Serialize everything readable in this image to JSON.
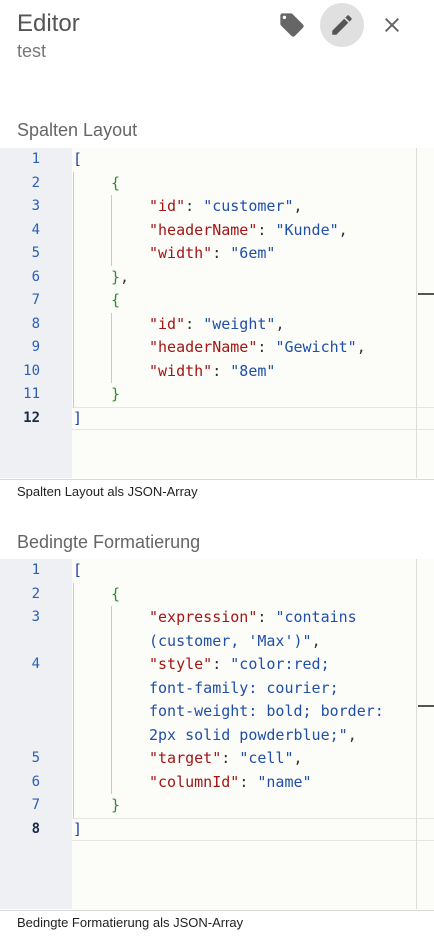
{
  "header": {
    "title": "Editor",
    "subtitle": "test"
  },
  "toolbar": {
    "tag_icon": "label-icon",
    "edit_icon": "pencil-icon",
    "close_icon": "close-icon"
  },
  "section1": {
    "title": "Spalten Layout",
    "hint": "Spalten Layout als JSON-Array",
    "lines": [
      {
        "n": "1",
        "indent": 0,
        "parts": [
          {
            "c": "p",
            "t": "["
          }
        ]
      },
      {
        "n": "2",
        "indent": 1,
        "parts": [
          {
            "c": "p2",
            "t": "{"
          }
        ]
      },
      {
        "n": "3",
        "indent": 2,
        "parts": [
          {
            "c": "k",
            "t": "\"id\""
          },
          {
            "c": "t",
            "t": ": "
          },
          {
            "c": "s",
            "t": "\"customer\""
          },
          {
            "c": "t",
            "t": ","
          }
        ]
      },
      {
        "n": "4",
        "indent": 2,
        "parts": [
          {
            "c": "k",
            "t": "\"headerName\""
          },
          {
            "c": "t",
            "t": ": "
          },
          {
            "c": "s",
            "t": "\"Kunde\""
          },
          {
            "c": "t",
            "t": ","
          }
        ]
      },
      {
        "n": "5",
        "indent": 2,
        "parts": [
          {
            "c": "k",
            "t": "\"width\""
          },
          {
            "c": "t",
            "t": ": "
          },
          {
            "c": "s",
            "t": "\"6em\""
          }
        ]
      },
      {
        "n": "6",
        "indent": 1,
        "parts": [
          {
            "c": "p2",
            "t": "}"
          },
          {
            "c": "t",
            "t": ","
          }
        ]
      },
      {
        "n": "7",
        "indent": 1,
        "parts": [
          {
            "c": "p2",
            "t": "{"
          }
        ]
      },
      {
        "n": "8",
        "indent": 2,
        "parts": [
          {
            "c": "k",
            "t": "\"id\""
          },
          {
            "c": "t",
            "t": ": "
          },
          {
            "c": "s",
            "t": "\"weight\""
          },
          {
            "c": "t",
            "t": ","
          }
        ]
      },
      {
        "n": "9",
        "indent": 2,
        "parts": [
          {
            "c": "k",
            "t": "\"headerName\""
          },
          {
            "c": "t",
            "t": ": "
          },
          {
            "c": "s",
            "t": "\"Gewicht\""
          },
          {
            "c": "t",
            "t": ","
          }
        ]
      },
      {
        "n": "10",
        "indent": 2,
        "parts": [
          {
            "c": "k",
            "t": "\"width\""
          },
          {
            "c": "t",
            "t": ": "
          },
          {
            "c": "s",
            "t": "\"8em\""
          }
        ]
      },
      {
        "n": "11",
        "indent": 1,
        "parts": [
          {
            "c": "p2",
            "t": "}"
          }
        ]
      },
      {
        "n": "12",
        "indent": 0,
        "current": true,
        "parts": [
          {
            "c": "p",
            "t": "]"
          }
        ]
      }
    ]
  },
  "section2": {
    "title": "Bedingte Formatierung",
    "hint": "Bedingte Formatierung als JSON-Array",
    "lines": [
      {
        "n": "1",
        "indent": 0,
        "parts": [
          {
            "c": "p",
            "t": "["
          }
        ]
      },
      {
        "n": "2",
        "indent": 1,
        "parts": [
          {
            "c": "p2",
            "t": "{"
          }
        ]
      },
      {
        "n": "3",
        "indent": 2,
        "parts": [
          {
            "c": "k",
            "t": "\"expression\""
          },
          {
            "c": "t",
            "t": ": "
          },
          {
            "c": "s",
            "t": "\"contains"
          }
        ]
      },
      {
        "n": "",
        "indent": 2,
        "parts": [
          {
            "c": "s",
            "t": "(customer, 'Max')\""
          },
          {
            "c": "t",
            "t": ","
          }
        ]
      },
      {
        "n": "4",
        "indent": 2,
        "parts": [
          {
            "c": "k",
            "t": "\"style\""
          },
          {
            "c": "t",
            "t": ": "
          },
          {
            "c": "s",
            "t": "\"color:red;"
          }
        ]
      },
      {
        "n": "",
        "indent": 2,
        "parts": [
          {
            "c": "s",
            "t": "font-family: courier;"
          }
        ]
      },
      {
        "n": "",
        "indent": 2,
        "parts": [
          {
            "c": "s",
            "t": "font-weight: bold; border:"
          }
        ]
      },
      {
        "n": "",
        "indent": 2,
        "parts": [
          {
            "c": "s",
            "t": "2px solid powderblue;\""
          },
          {
            "c": "t",
            "t": ","
          }
        ]
      },
      {
        "n": "5",
        "indent": 2,
        "parts": [
          {
            "c": "k",
            "t": "\"target\""
          },
          {
            "c": "t",
            "t": ": "
          },
          {
            "c": "s",
            "t": "\"cell\""
          },
          {
            "c": "t",
            "t": ","
          }
        ]
      },
      {
        "n": "6",
        "indent": 2,
        "parts": [
          {
            "c": "k",
            "t": "\"columnId\""
          },
          {
            "c": "t",
            "t": ": "
          },
          {
            "c": "s",
            "t": "\"name\""
          }
        ]
      },
      {
        "n": "7",
        "indent": 1,
        "parts": [
          {
            "c": "p2",
            "t": "}"
          }
        ]
      },
      {
        "n": "8",
        "indent": 0,
        "current": true,
        "parts": [
          {
            "c": "p",
            "t": "]"
          }
        ]
      }
    ]
  }
}
